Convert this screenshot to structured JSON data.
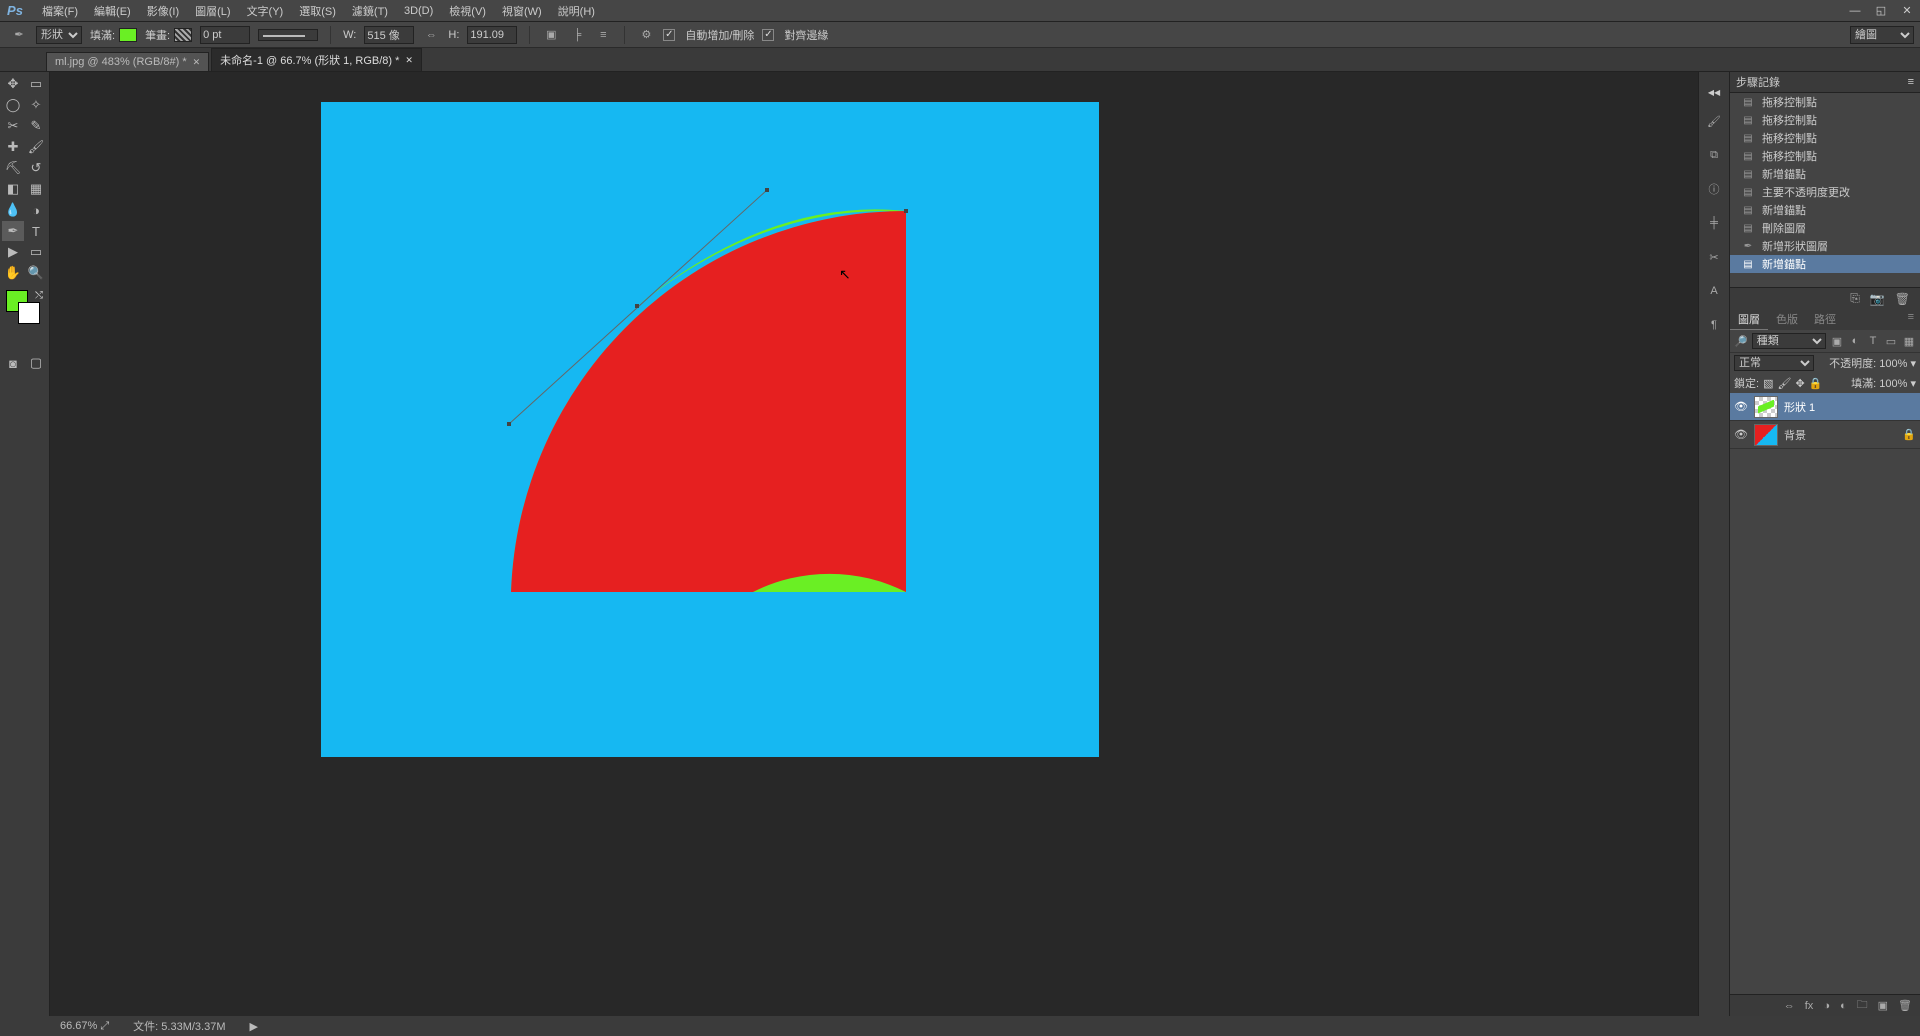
{
  "menu": {
    "items": [
      "檔案(F)",
      "編輯(E)",
      "影像(I)",
      "圖層(L)",
      "文字(Y)",
      "選取(S)",
      "濾鏡(T)",
      "3D(D)",
      "檢視(V)",
      "視窗(W)",
      "說明(H)"
    ]
  },
  "options": {
    "mode_label": "形狀",
    "fill_label": "填滿:",
    "stroke_label": "筆畫:",
    "stroke_width": "0 pt",
    "w_label": "W:",
    "w_value": "515 像",
    "h_label": "H:",
    "h_value": "191.09",
    "auto_add_label": "自動增加/刪除",
    "align_edges_label": "對齊邊緣",
    "right_mode": "繪圖"
  },
  "tabs": [
    {
      "label": "ml.jpg @ 483% (RGB/8#) *",
      "active": false
    },
    {
      "label": "未命名-1 @ 66.7% (形狀 1, RGB/8) *",
      "active": true
    }
  ],
  "colors": {
    "fg": "#6aef24",
    "bg": "#ffffff",
    "accent": "#5a7aa0",
    "canvas": "#16b8f2",
    "shape_red": "#e62020"
  },
  "history": {
    "title": "步驟記錄",
    "items": [
      "拖移控制點",
      "拖移控制點",
      "拖移控制點",
      "拖移控制點",
      "新增錨點",
      "主要不透明度更改",
      "新增錨點",
      "刪除圖層",
      "新增形狀圖層",
      "新增錨點"
    ],
    "selected_index": 9
  },
  "layers": {
    "tabs": [
      "圖層",
      "色版",
      "路徑"
    ],
    "active_tab": 0,
    "filter": "種類",
    "blend": "正常",
    "opacity_label": "不透明度:",
    "opacity": "100%",
    "lock_label": "鎖定:",
    "fill_label": "填滿:",
    "fill_value": "100%",
    "items": [
      {
        "name": "形狀 1",
        "selected": true,
        "kind": "shape"
      },
      {
        "name": "背景",
        "selected": false,
        "kind": "bg",
        "locked": true
      }
    ]
  },
  "status": {
    "zoom": "66.67%",
    "doc_label": "文件:",
    "doc_value": "5.33M/3.37M"
  }
}
